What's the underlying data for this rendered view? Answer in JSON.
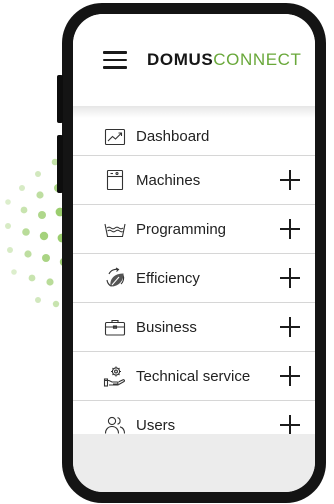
{
  "brand": {
    "bold": "DOMUS",
    "light": "CONNECT",
    "accent_color": "#69a83a"
  },
  "menu": {
    "items": [
      {
        "label": "Dashboard",
        "icon": "chart-line-icon",
        "expandable": false
      },
      {
        "label": "Machines",
        "icon": "washing-machine-icon",
        "expandable": true
      },
      {
        "label": "Programming",
        "icon": "wash-tub-icon",
        "expandable": true
      },
      {
        "label": "Efficiency",
        "icon": "eco-leaf-icon",
        "expandable": true
      },
      {
        "label": "Business",
        "icon": "briefcase-icon",
        "expandable": true
      },
      {
        "label": "Technical service",
        "icon": "service-gear-hand-icon",
        "expandable": true
      },
      {
        "label": "Users",
        "icon": "users-icon",
        "expandable": true
      }
    ]
  }
}
